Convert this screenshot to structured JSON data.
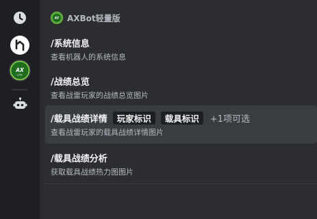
{
  "app": {
    "name": "AXBot轻量版",
    "avatar_text": "AXBot LITE"
  },
  "sidebar": {
    "items": [
      {
        "icon": "clock-icon"
      },
      {
        "icon": "app-logo-icon"
      },
      {
        "icon": "axbot-lite-icon",
        "text": "AXBot LITE"
      },
      {
        "icon": "robot-icon"
      }
    ]
  },
  "commands": [
    {
      "name": "/系统信息",
      "description": "查看机器人的系统信息"
    },
    {
      "name": "/战绩总览",
      "description": "查看战雷玩家的战绩总览图片"
    },
    {
      "name": "/载具战绩详情",
      "description": "查看战雷玩家的载具战绩详情图片",
      "options": [
        "玩家标识",
        "载具标识"
      ],
      "more": "+1项可选"
    },
    {
      "name": "/载具战绩分析",
      "description": "获取载具战绩热力图图片"
    }
  ],
  "colors": {
    "rail_bg": "#1e1f22",
    "panel_bg": "#2b2d31",
    "active_row": "#393c41",
    "accent_green": "#1c7a1c"
  }
}
